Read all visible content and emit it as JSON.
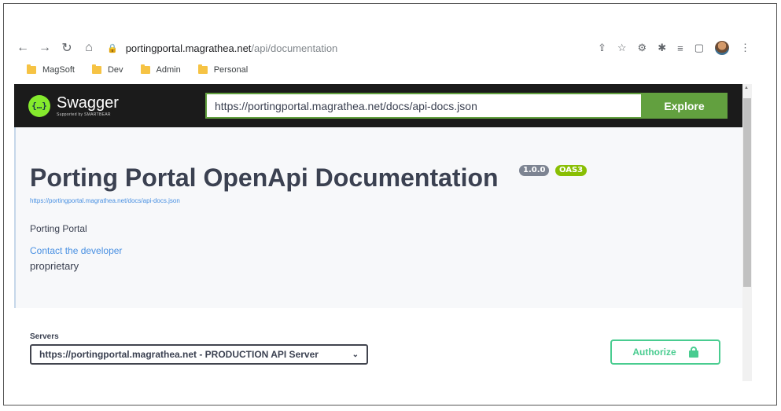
{
  "browser": {
    "url_host": "portingportal.magrathea.net",
    "url_path": "/api/documentation",
    "bookmarks": [
      "MagSoft",
      "Dev",
      "Admin",
      "Personal"
    ]
  },
  "swagger": {
    "logo_name": "Swagger",
    "logo_sub": "Supported by SMARTBEAR",
    "spec_url": "https://portingportal.magrathea.net/docs/api-docs.json",
    "explore_label": "Explore"
  },
  "info": {
    "title": "Porting Portal OpenApi Documentation",
    "version_badge": "1.0.0",
    "oas_badge": "OAS3",
    "spec_link": "https://portingportal.magrathea.net/docs/api-docs.json",
    "description": "Porting Portal",
    "contact_label": "Contact the developer",
    "license": "proprietary"
  },
  "servers": {
    "label": "Servers",
    "selected": "https://portingportal.magrathea.net - PRODUCTION API Server"
  },
  "authorize_label": "Authorize",
  "colors": {
    "topbar": "#1b1b1b",
    "swagger_green": "#85ea2d",
    "explore_green": "#62a03f",
    "authorize_green": "#49cc90",
    "link_blue": "#4990e2"
  }
}
